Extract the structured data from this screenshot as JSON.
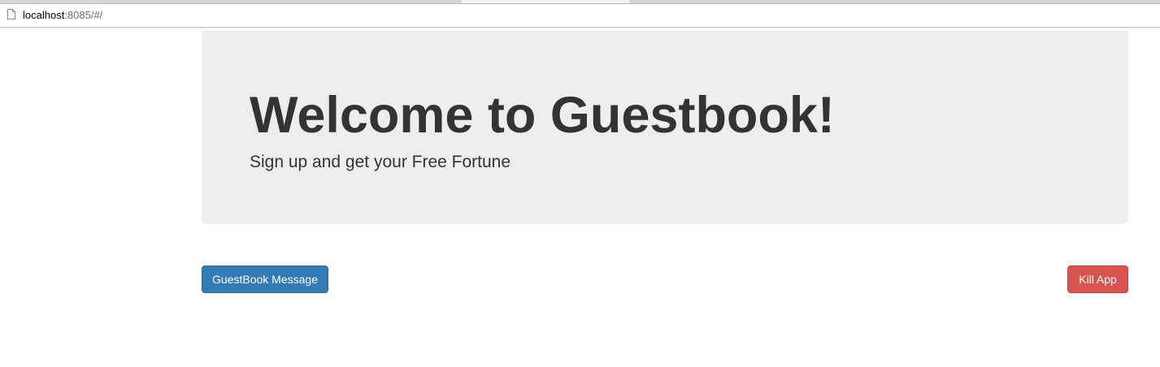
{
  "browser": {
    "url_host": "localhost",
    "url_rest": ":8085/#/"
  },
  "jumbotron": {
    "title": "Welcome to Guestbook!",
    "lead": "Sign up and get your Free Fortune"
  },
  "actions": {
    "guestbook_message_label": "GuestBook Message",
    "kill_app_label": "Kill App"
  },
  "colors": {
    "primary": "#337ab7",
    "danger": "#d9534f",
    "jumbotron_bg": "#eeeeee",
    "text": "#333333"
  }
}
